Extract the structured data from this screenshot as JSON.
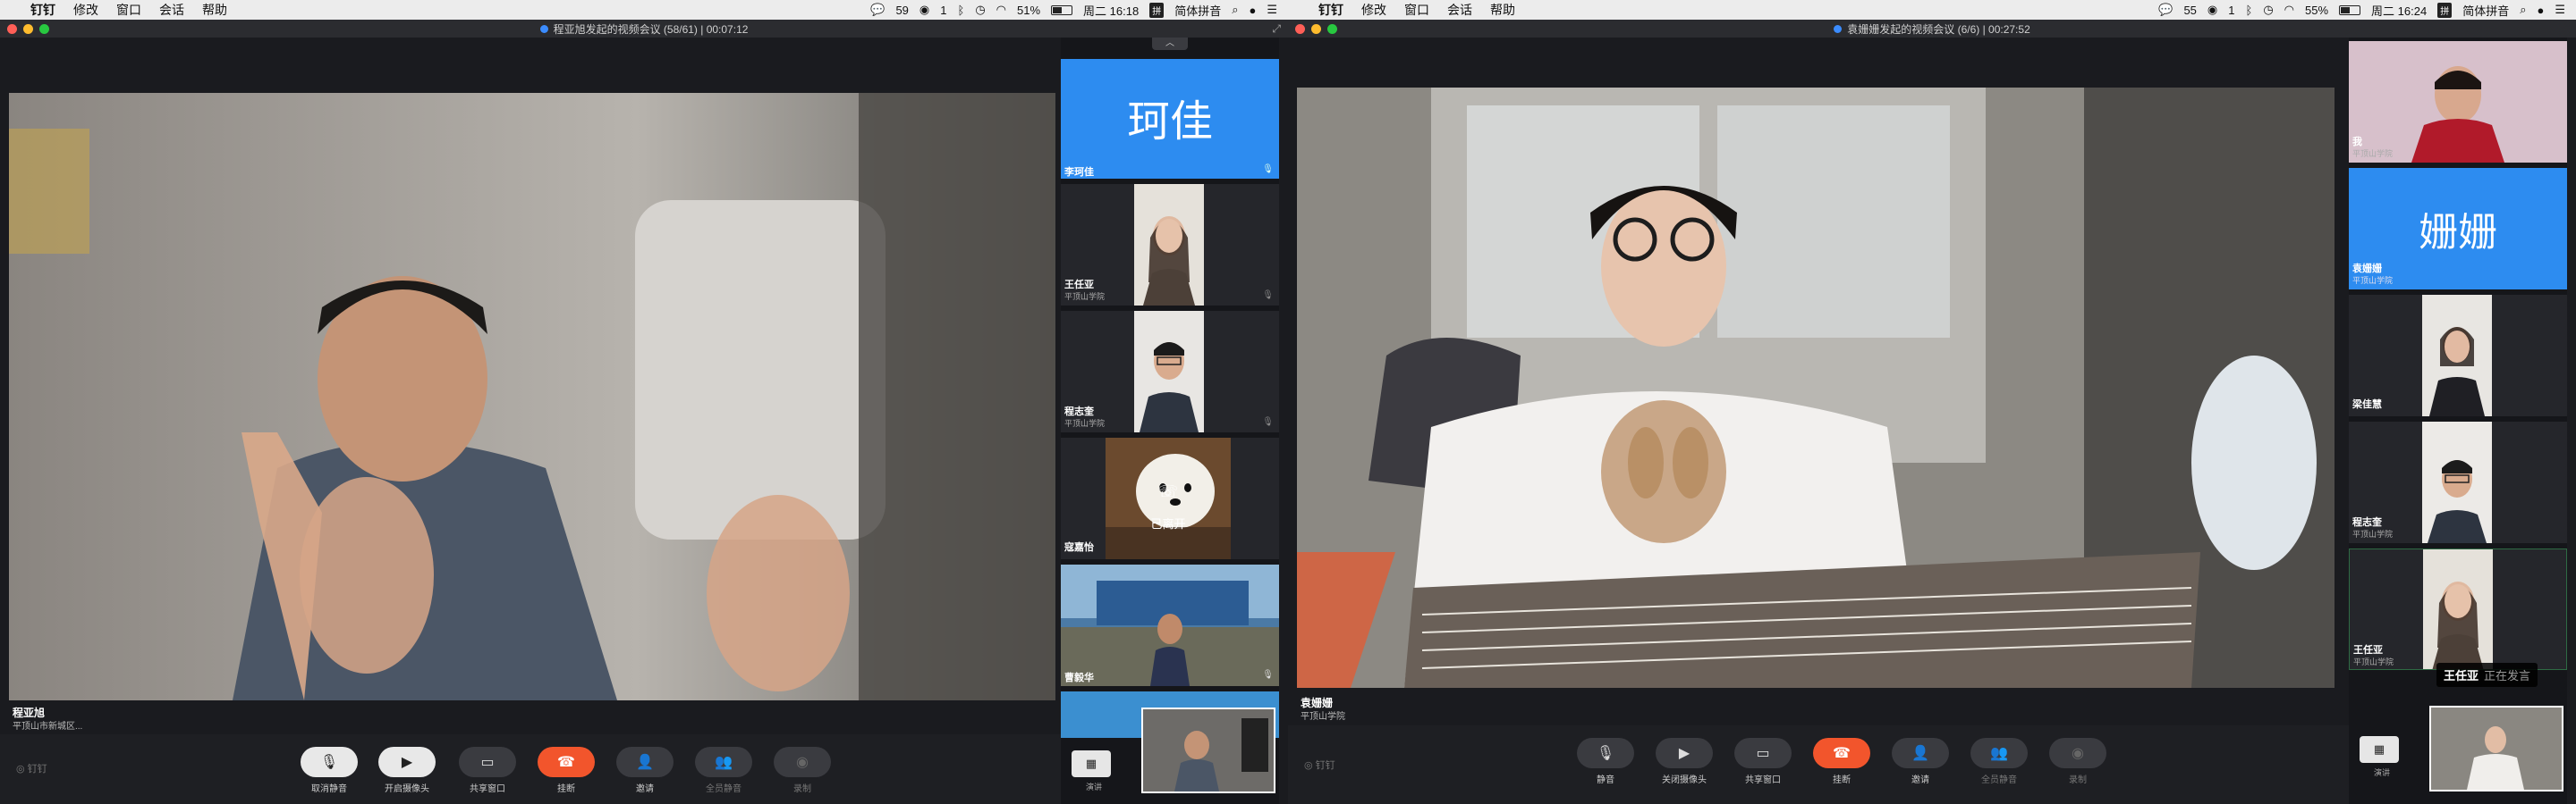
{
  "left": {
    "menubar": {
      "app": "钉钉",
      "items": [
        "修改",
        "窗口",
        "会话",
        "帮助"
      ],
      "wechat_count": "59",
      "notif_count": "1",
      "battery": "51%",
      "battery_level": 0.51,
      "datetime": "周二 16:18",
      "ime": "简体拼音"
    },
    "window": {
      "title": "程亚旭发起的视频会议 (58/61) | 00:07:12"
    },
    "main": {
      "speaker_name": "程亚旭",
      "speaker_org": "平顶山市新城区..."
    },
    "sidebar": {
      "tiles": [
        {
          "avatar_text": "珂佳",
          "name": "李珂佳",
          "org": ""
        },
        {
          "name": "王任亚",
          "org": "平顶山学院"
        },
        {
          "name": "程志奎",
          "org": "平顶山学院"
        },
        {
          "name": "寇嘉怡",
          "org": "",
          "left_text": "已离开"
        },
        {
          "name": "曹毅华",
          "org": ""
        }
      ]
    },
    "toolbar": {
      "logo": "钉钉",
      "buttons": [
        {
          "label": "取消静音",
          "icon": "mic-off-icon",
          "glyph": "🎙"
        },
        {
          "label": "开启摄像头",
          "icon": "camera-icon",
          "glyph": "▶"
        },
        {
          "label": "共享窗口",
          "icon": "share-screen-icon",
          "glyph": "▭"
        },
        {
          "label": "挂断",
          "icon": "hangup-icon",
          "glyph": "☎"
        },
        {
          "label": "邀请",
          "icon": "invite-icon",
          "glyph": "👤"
        },
        {
          "label": "全员静音",
          "icon": "mute-all-icon",
          "glyph": "👥"
        },
        {
          "label": "录制",
          "icon": "record-icon",
          "glyph": "◉"
        }
      ],
      "layout_label": "演讲"
    }
  },
  "right": {
    "menubar": {
      "app": "钉钉",
      "items": [
        "修改",
        "窗口",
        "会话",
        "帮助"
      ],
      "wechat_count": "55",
      "notif_count": "1",
      "battery": "55%",
      "battery_level": 0.55,
      "datetime": "周二 16:24",
      "ime": "简体拼音"
    },
    "window": {
      "title": "袁姗姗发起的视频会议 (6/6) | 00:27:52"
    },
    "main": {
      "speaker_name": "袁姗姗",
      "speaker_org": "平顶山学院"
    },
    "sidebar": {
      "tiles": [
        {
          "name": "我",
          "org": "平顶山学院"
        },
        {
          "avatar_text": "姗姗",
          "name": "袁姗姗",
          "org": "平顶山学院"
        },
        {
          "name": "梁佳慧",
          "org": ""
        },
        {
          "name": "程志奎",
          "org": "平顶山学院"
        },
        {
          "name": "王任亚",
          "org": "平顶山学院"
        }
      ]
    },
    "speaking": {
      "name": "王任亚",
      "status": "正在发言"
    },
    "toolbar": {
      "logo": "钉钉",
      "buttons": [
        {
          "label": "静音",
          "icon": "mic-icon",
          "glyph": "🎙"
        },
        {
          "label": "关闭摄像头",
          "icon": "camera-icon",
          "glyph": "▶"
        },
        {
          "label": "共享窗口",
          "icon": "share-screen-icon",
          "glyph": "▭"
        },
        {
          "label": "挂断",
          "icon": "hangup-icon",
          "glyph": "☎"
        },
        {
          "label": "邀请",
          "icon": "invite-icon",
          "glyph": "👤"
        },
        {
          "label": "全员静音",
          "icon": "mute-all-icon",
          "glyph": "👥"
        },
        {
          "label": "录制",
          "icon": "record-icon",
          "glyph": "◉"
        }
      ],
      "layout_label": "演讲"
    }
  }
}
